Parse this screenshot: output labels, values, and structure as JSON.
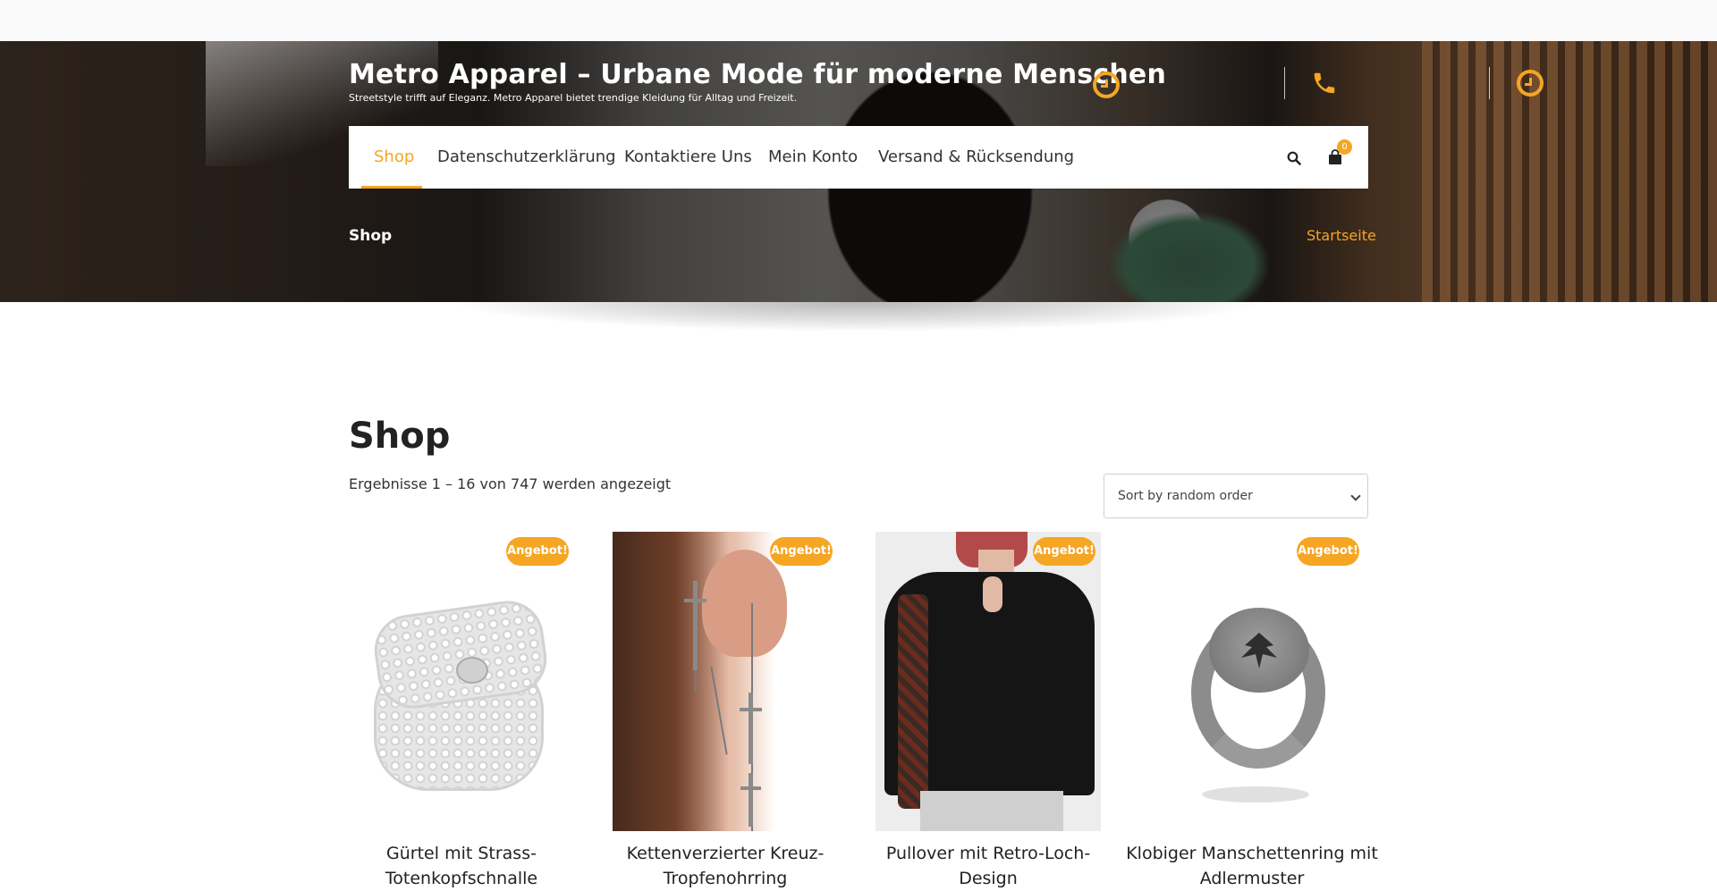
{
  "header": {
    "site_title": "Metro Apparel – Urbane Mode für moderne Menschen",
    "tagline": "Streetstyle trifft auf Eleganz. Metro Apparel bietet trendige Kleidung für Alltag und Freizeit.",
    "icons": [
      "clock-icon",
      "phone-icon",
      "clock-icon"
    ],
    "accent_color": "#f5a623"
  },
  "nav": {
    "items": [
      {
        "label": "Shop",
        "active": true
      },
      {
        "label": "Datenschutzerklärung",
        "active": false
      },
      {
        "label": "Kontaktiere Uns",
        "active": false
      },
      {
        "label": "Mein Konto",
        "active": false
      },
      {
        "label": "Versand & Rücksendung",
        "active": false
      }
    ],
    "cart_count": "0"
  },
  "breadcrumb": {
    "current": "Shop",
    "home_link": "Startseite"
  },
  "main": {
    "heading": "Shop",
    "result_count": "Ergebnisse 1 – 16 von 747 werden angezeigt",
    "sort": {
      "selected": "Sort by random order"
    }
  },
  "products": [
    {
      "name": "Gürtel mit Strass-Totenkopfschnalle",
      "badge": "Angebot!"
    },
    {
      "name": "Kettenverzierter Kreuz-Tropfenohrring",
      "badge": "Angebot!"
    },
    {
      "name": "Pullover mit Retro-Loch-Design",
      "badge": "Angebot!"
    },
    {
      "name": "Klobiger Manschettenring mit Adlermuster",
      "badge": "Angebot!"
    }
  ]
}
